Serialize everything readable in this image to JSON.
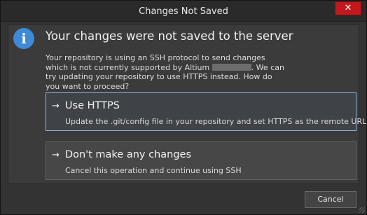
{
  "window": {
    "title": "Changes Not Saved",
    "close_symbol": "✕"
  },
  "message": {
    "icon": "info-icon",
    "icon_glyph": "i",
    "heading": "Your changes were not saved to the server",
    "body_part1": "Your repository is using an SSH protocol to send changes which is not currently supported by Altium",
    "body_part2": ". We can try updating your repository to use HTTPS instead. How do you want to proceed?"
  },
  "options": [
    {
      "arrow": "→",
      "title": "Use HTTPS",
      "subtitle": "Update the .git/config file in your repository and set HTTPS as the remote URL"
    },
    {
      "arrow": "→",
      "title": "Don't make any changes",
      "subtitle": "Cancel this operation and continue using SSH"
    }
  ],
  "footer": {
    "cancel_label": "Cancel"
  },
  "colors": {
    "accent": "#3e8ad8",
    "close": "#c3181d",
    "selected_border": "#8fb3d6"
  }
}
